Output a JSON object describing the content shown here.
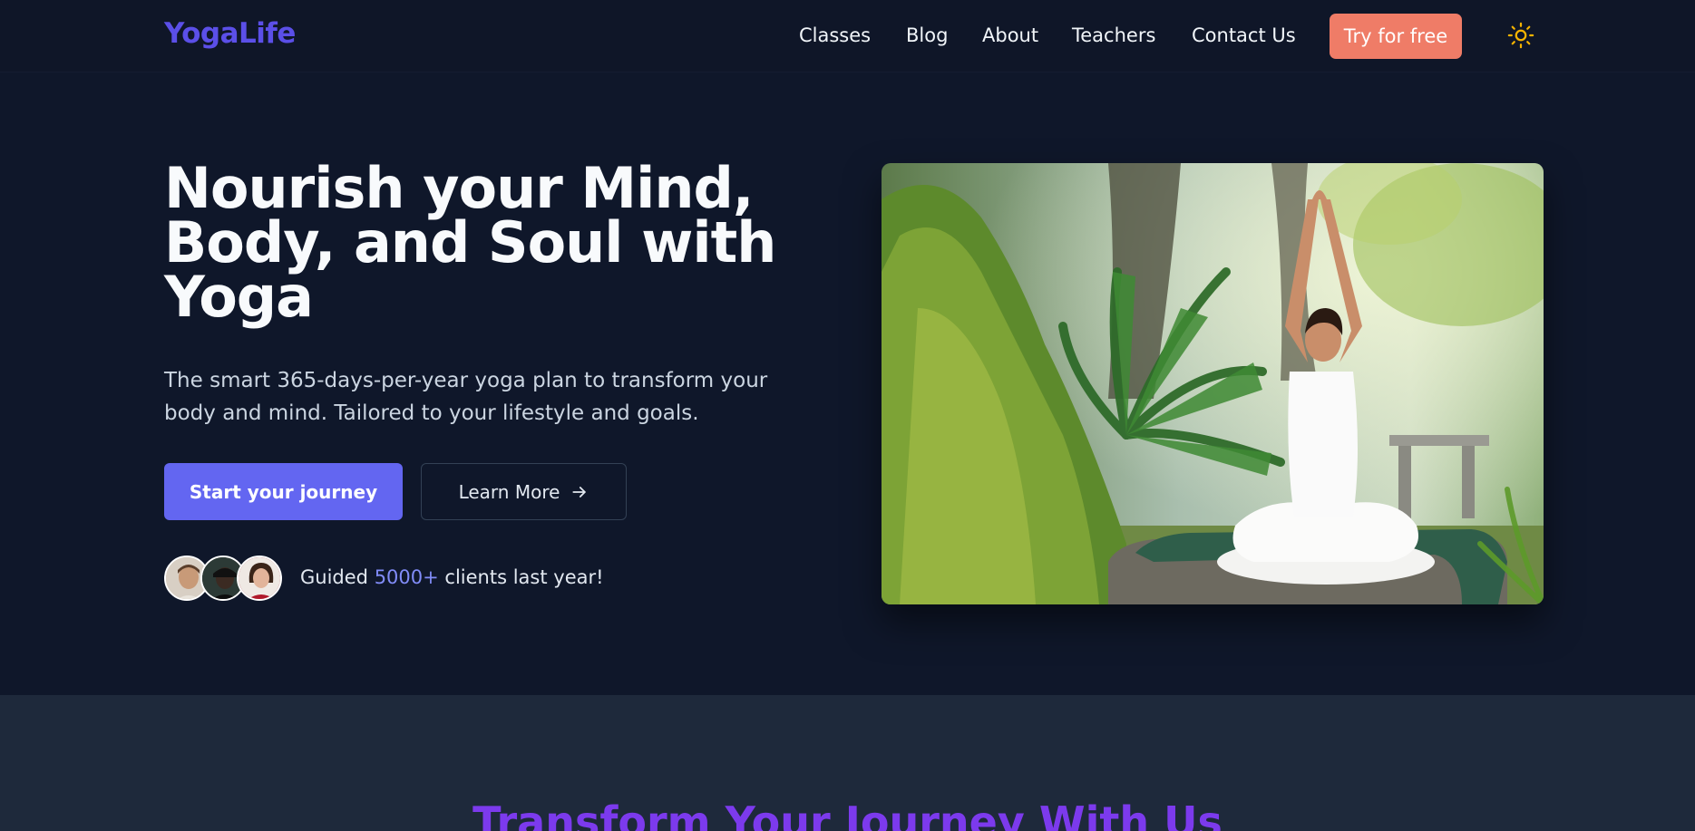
{
  "nav": {
    "logo": "YogaLife",
    "links": [
      "Classes",
      "Blog",
      "About",
      "Teachers",
      "Contact Us"
    ],
    "cta": "Try for free",
    "theme_icon": "sun-icon"
  },
  "hero": {
    "title": "Nourish your Mind, Body, and Soul with Yoga",
    "subtitle": "The smart 365-days-per-year yoga plan to transform your body and mind. Tailored to your lifestyle and goals.",
    "primary_button": "Start your journey",
    "secondary_button": "Learn More",
    "secondary_icon": "arrow-right-icon",
    "social": {
      "prefix": "Guided",
      "highlight": "5000+",
      "suffix": "clients last year!"
    }
  },
  "section2": {
    "title": "Transform Your Journey With Us"
  },
  "colors": {
    "background": "#0f172a",
    "brand": "#5b4fe8",
    "accent_button": "#6366f1",
    "cta": "#ef7c67",
    "highlight": "#818cf8",
    "section_title": "#7c3aed",
    "sun": "#f5b301"
  }
}
